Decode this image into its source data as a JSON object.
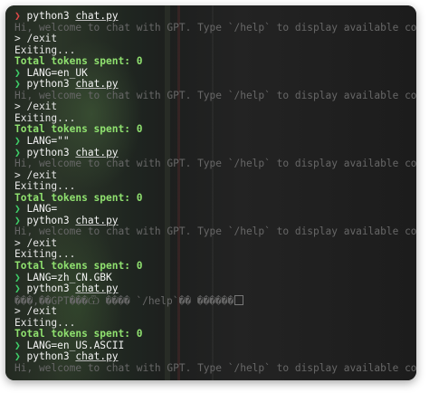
{
  "colors": {
    "prompt": "#3fd06a",
    "prompt_first": "#e04848",
    "welcome_dim": "#676767",
    "total": "#8fe06f",
    "background": "#1e201f"
  },
  "prompt_glyph": "❯",
  "lines": [
    {
      "type": "prompt",
      "first": true,
      "cmd": "python3",
      "arg": "chat.py"
    },
    {
      "type": "dim",
      "text": "Hi, welcome to chat with GPT. Type `/help` to display available commands."
    },
    {
      "type": "plain",
      "text": "> /exit"
    },
    {
      "type": "plain",
      "text": "Exiting..."
    },
    {
      "type": "total",
      "text": "Total tokens spent: 0"
    },
    {
      "type": "prompt",
      "cmd": "LANG=en_UK"
    },
    {
      "type": "prompt",
      "cmd": "python3",
      "arg": "chat.py"
    },
    {
      "type": "dim",
      "text": "Hi, welcome to chat with GPT. Type `/help` to display available commands."
    },
    {
      "type": "plain",
      "text": "> /exit"
    },
    {
      "type": "plain",
      "text": "Exiting..."
    },
    {
      "type": "total",
      "text": "Total tokens spent: 0"
    },
    {
      "type": "prompt",
      "cmd": "LANG=\"\""
    },
    {
      "type": "prompt",
      "cmd": "python3",
      "arg": "chat.py"
    },
    {
      "type": "dim",
      "text": "Hi, welcome to chat with GPT. Type `/help` to display available commands."
    },
    {
      "type": "plain",
      "text": "> /exit"
    },
    {
      "type": "plain",
      "text": "Exiting..."
    },
    {
      "type": "total",
      "text": "Total tokens spent: 0"
    },
    {
      "type": "prompt",
      "cmd": "LANG="
    },
    {
      "type": "prompt",
      "cmd": "python3",
      "arg": "chat.py"
    },
    {
      "type": "dim",
      "text": "Hi, welcome to chat with GPT. Type `/help` to display available commands."
    },
    {
      "type": "plain",
      "text": "> /exit"
    },
    {
      "type": "plain",
      "text": "Exiting..."
    },
    {
      "type": "total",
      "text": "Total tokens spent: 0"
    },
    {
      "type": "prompt",
      "cmd": "LANG=zh_CN.GBK"
    },
    {
      "type": "prompt",
      "cmd": "python3",
      "arg": "chat.py"
    },
    {
      "type": "dim",
      "text": "���,��GPT���Ѿ ���� `/help`�� ������",
      "box": true
    },
    {
      "type": "plain",
      "text": "> /exit"
    },
    {
      "type": "plain",
      "text": "Exiting..."
    },
    {
      "type": "total",
      "text": "Total tokens spent: 0"
    },
    {
      "type": "prompt",
      "cmd": "LANG=en_US.ASCII"
    },
    {
      "type": "prompt",
      "cmd": "python3",
      "arg": "chat.py"
    },
    {
      "type": "dim",
      "text": "Hi, welcome to chat with GPT. Type `/help` to display available commands."
    }
  ]
}
